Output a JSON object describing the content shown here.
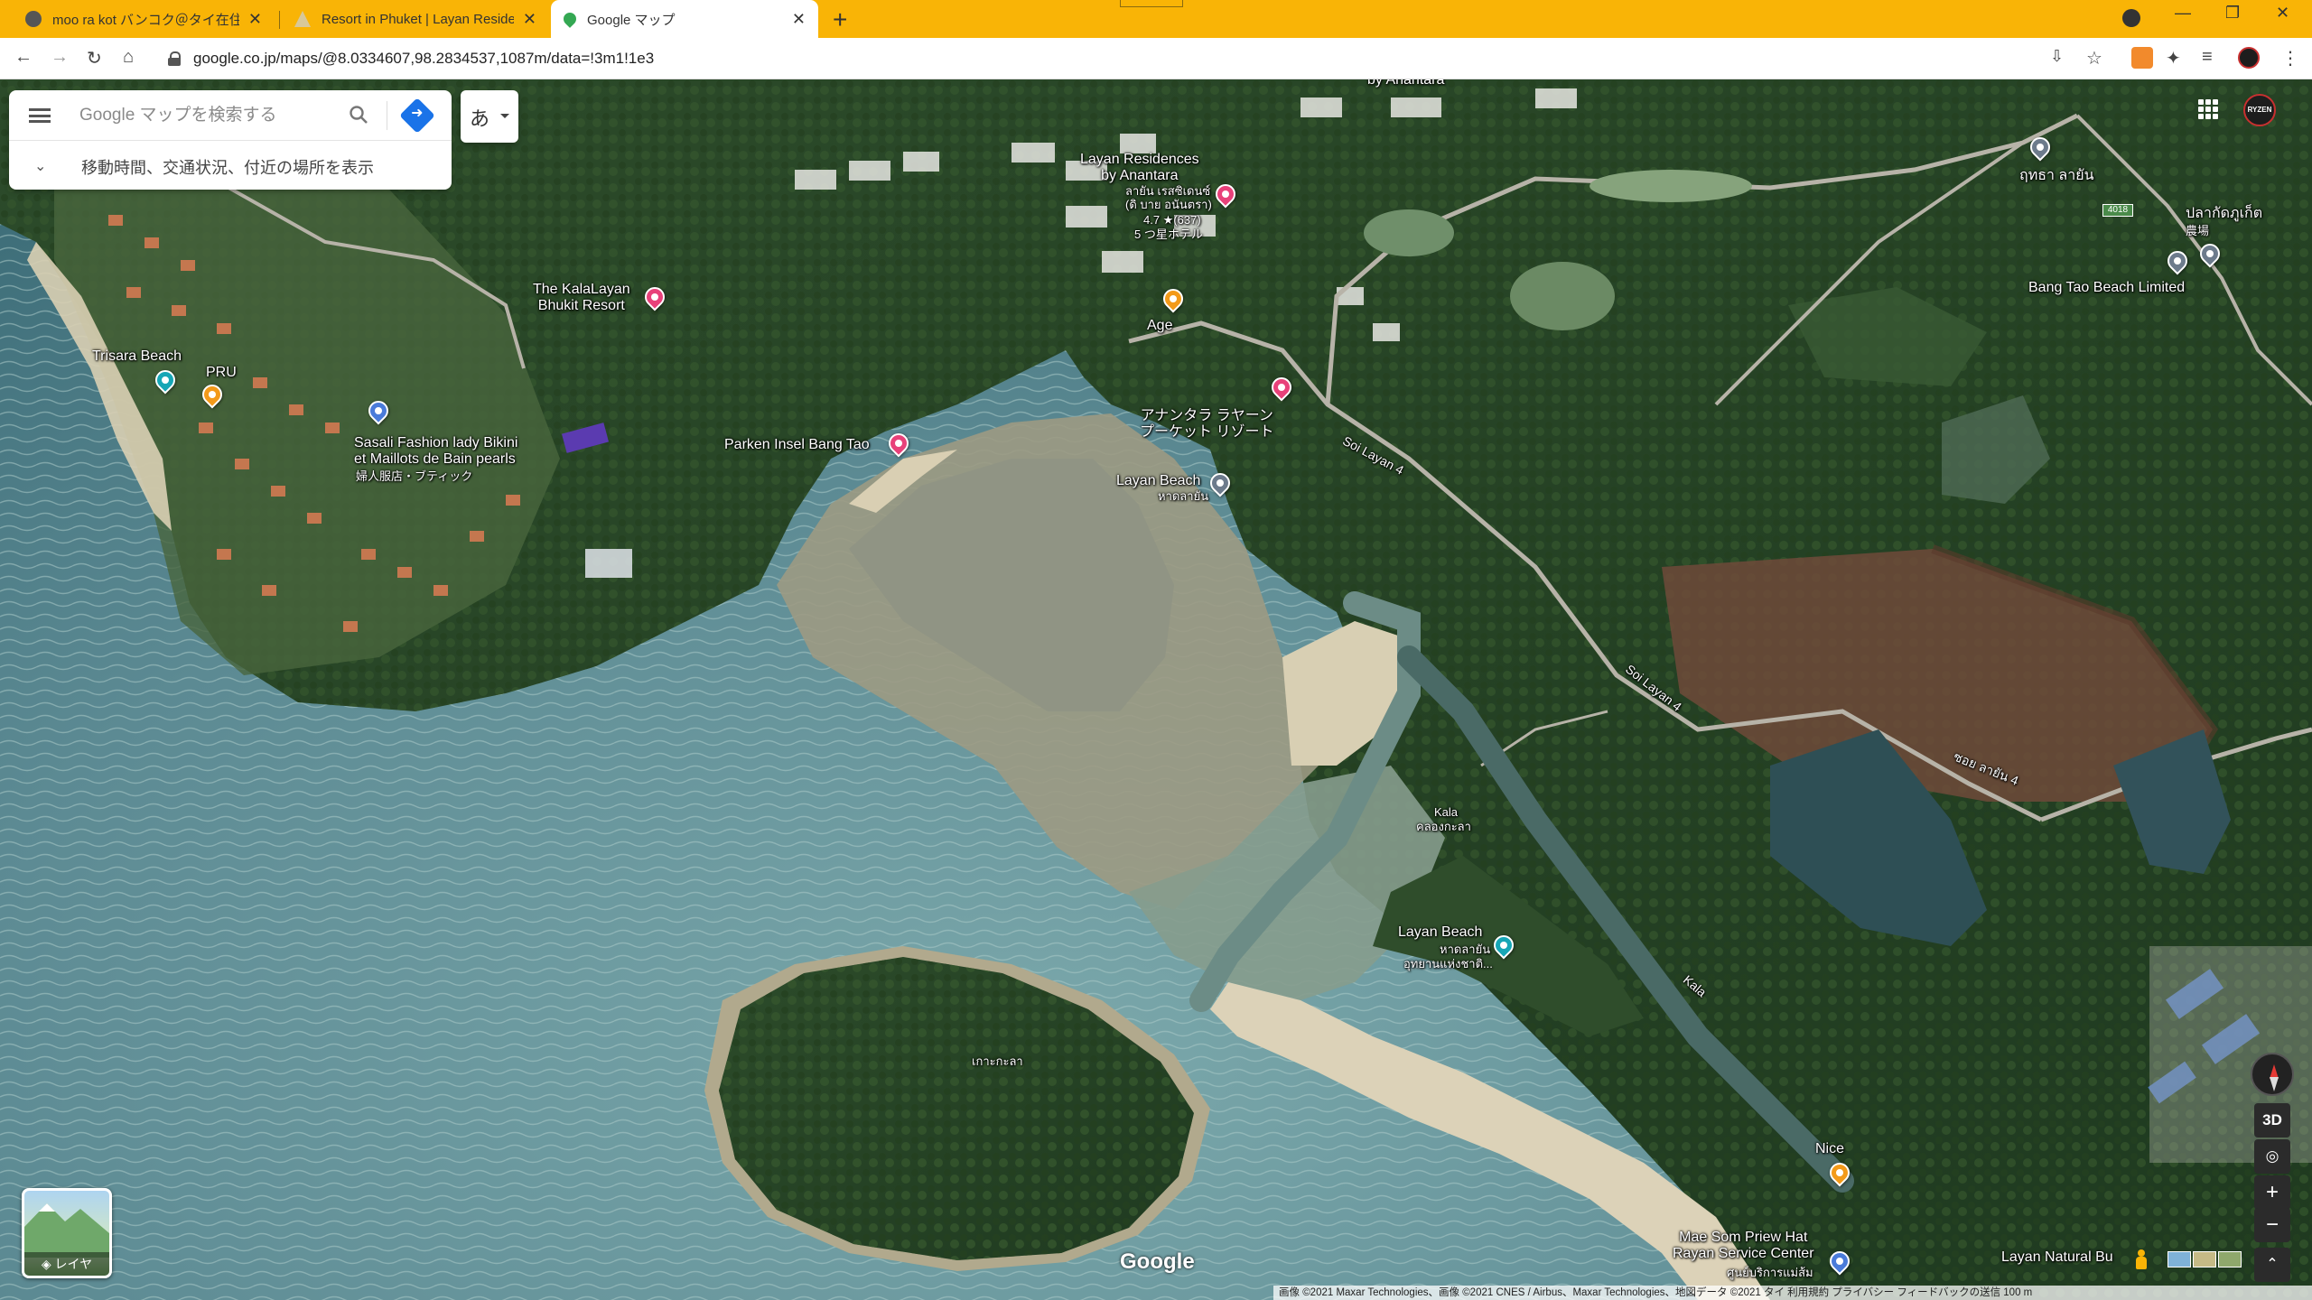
{
  "browser": {
    "tabs": [
      {
        "title": "moo ra kot バンコク＠タイ在住／非"
      },
      {
        "title": "Resort in Phuket | Layan Residen"
      },
      {
        "title": "Google マップ"
      }
    ],
    "url": "google.co.jp/maps/@8.0334607,98.2834537,1087m/data=!3m1!1e3"
  },
  "search": {
    "placeholder": "Google マップを検索する",
    "hint": "移動時間、交通状況、付近の場所を表示",
    "ime_label": "あ"
  },
  "places": {
    "by_anantara": "by Anantara",
    "layan_residences": "Layan Residences\nby Anantara",
    "layan_residences_thai": "ลายัน เรสซิเดนซ์",
    "layan_residences_sub": "(ดิ บาย อนันตรา)",
    "layan_residences_rating": "4.7 ★(637)",
    "layan_residences_class": "5 つ星ホテル",
    "age": "Age",
    "anantara_resort": "アナンタラ ラヤーン\nプーケット リゾート",
    "layan_beach_top": "Layan Beach",
    "layan_beach_top_thai": "หาดลายัน",
    "kalalayan": "The KalaLayan\nBhukit Resort",
    "trisara": "Trisara Beach",
    "pru": "PRU",
    "sasali": "Sasali Fashion lady Bikini\net Maillots de Bain pearls",
    "sasali_sub": "婦人服店・ブティック",
    "parken": "Parken Insel Bang Tao",
    "soi_layan_4_a": "Soi Layan 4",
    "soi_layan_4_b": "Soi Layan 4",
    "soi_thai": "ซอย ลายัน 4",
    "kala_water": "Kala",
    "kala_water_thai": "คลองกะลา",
    "layan_beach_main": "Layan Beach",
    "layan_beach_main_thai": "หาดลายัน",
    "layan_beach_main_sub": "อุทยานแห่งชาติ...",
    "kala_stream": "Kala",
    "island": "เกาะกะลา",
    "nice": "Nice",
    "mae_som": "Mae Som Priew Hat\nRayan Service Center",
    "mae_som_thai": "ศูนย์บริการแม่ส้ม",
    "layan_natural": "Layan Natural Bu",
    "thi_layan": "ฤทธา ลายัน",
    "plakat_thai": "ปลากัดภูเก็ต",
    "plakat_sub": "農場",
    "bang_tao_beach_limited": "Bang Tao Beach Limited",
    "route_badge": "4018"
  },
  "controls": {
    "layers_label": "レイヤ",
    "three_d": "3D",
    "zoom_in": "+",
    "zoom_out": "−"
  },
  "footer": {
    "google": "Google",
    "attribution": "画像 ©2021 Maxar Technologies、画像 ©2021 CNES / Airbus、Maxar Technologies、地図データ ©2021    タイ    利用規約    プライバシー    フィードバックの送信    100 m"
  },
  "colors": {
    "chrome": "#f9b406",
    "hotel_pin": "#e8417a",
    "food_pin": "#f39a1a",
    "beach_pin": "#16a6b6",
    "shop_pin": "#4a7bd9",
    "direction_button": "#1a73e8"
  }
}
